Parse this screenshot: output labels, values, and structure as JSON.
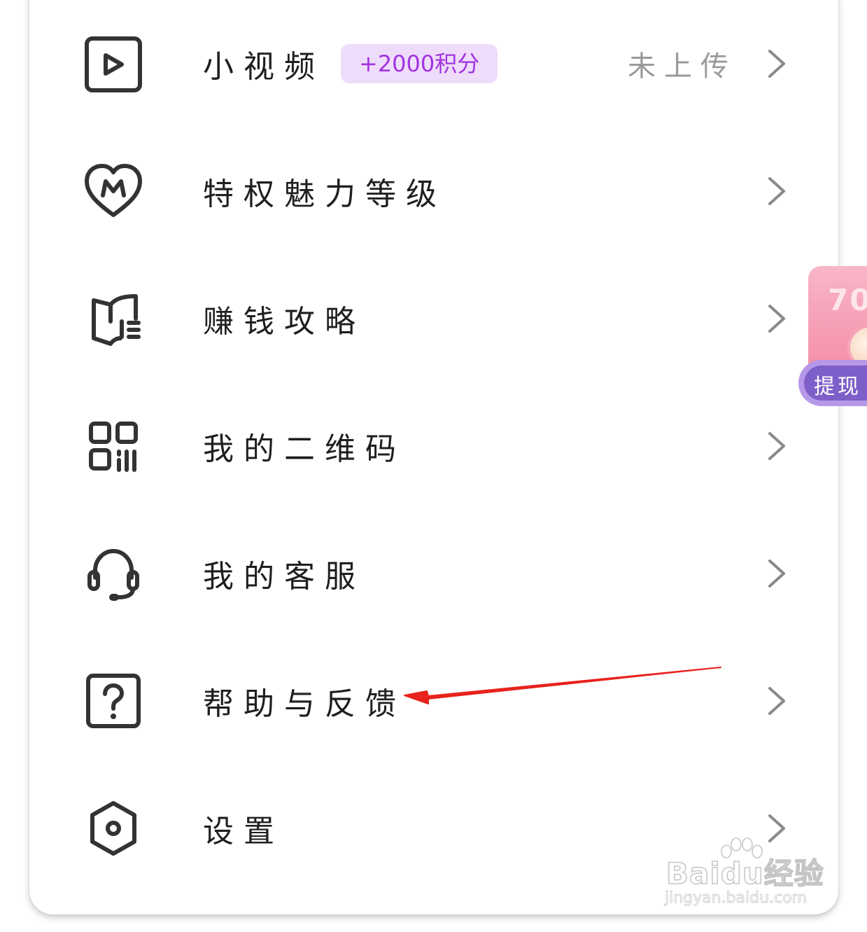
{
  "menu": {
    "items": [
      {
        "icon": "play-video-icon",
        "label": "小视频",
        "badge": "+2000积分",
        "status": "未上传"
      },
      {
        "icon": "heart-m-icon",
        "label": "特权魅力等级"
      },
      {
        "icon": "guide-book-icon",
        "label": "赚钱攻略"
      },
      {
        "icon": "qr-code-icon",
        "label": "我的二维码"
      },
      {
        "icon": "headset-icon",
        "label": "我的客服"
      },
      {
        "icon": "question-mark-icon",
        "label": "帮助与反馈"
      },
      {
        "icon": "settings-hexagon-icon",
        "label": "设置"
      }
    ]
  },
  "floating_widget": {
    "amount": "70",
    "label": "提现"
  },
  "watermark": {
    "brand": "Baidu经验",
    "url": "jingyan.baidu.com"
  },
  "colors": {
    "badge_bg": "#efdcfb",
    "badge_text": "#a133e0",
    "arrow": "#e8221d",
    "label_text": "#1f1f1f",
    "status_text": "#9a9a9a",
    "chevron": "#8a8a8a"
  }
}
